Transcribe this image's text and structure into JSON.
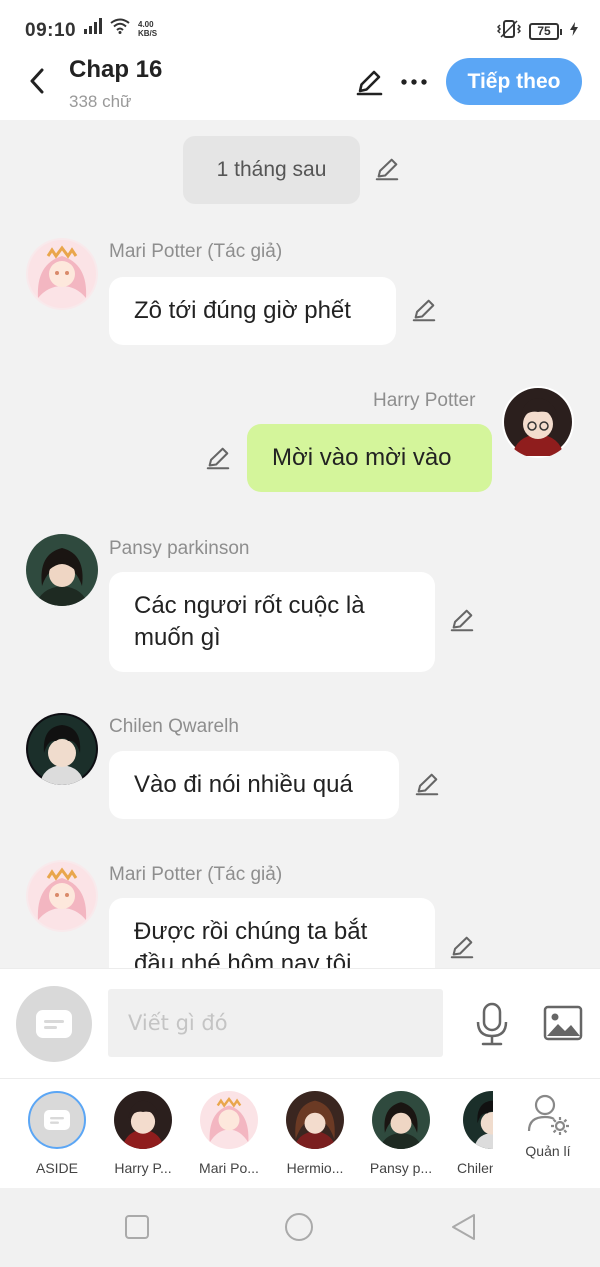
{
  "status_bar": {
    "time": "09:10",
    "net_speed_value": "4.00",
    "net_speed_unit": "KB/S",
    "battery": "75"
  },
  "header": {
    "title": "Chap 16",
    "subtitle": "338 chữ",
    "next_label": "Tiếp theo"
  },
  "chat": {
    "time_chip": "1 tháng sau",
    "messages": [
      {
        "sender": "Mari Potter (Tác giả)",
        "text": "Zô tới đúng giờ phết",
        "side": "left"
      },
      {
        "sender": "Harry Potter",
        "text": "Mời vào mời vào",
        "side": "right"
      },
      {
        "sender": "Pansy parkinson",
        "text": "Các ngươi rốt cuộc là muốn gì",
        "side": "left"
      },
      {
        "sender": "Chilen Qwarelh",
        "text": "Vào đi nói nhiều quá",
        "side": "left"
      },
      {
        "sender": "Mari Potter (Tác giả)",
        "text": "Được rồi chúng ta bắt đầu nhé hôm nay tôi",
        "side": "left"
      }
    ]
  },
  "input": {
    "placeholder": "Viết gì đó"
  },
  "characters": [
    {
      "label": "ASIDE"
    },
    {
      "label": "Harry P..."
    },
    {
      "label": "Mari Po..."
    },
    {
      "label": "Hermio..."
    },
    {
      "label": "Pansy p..."
    },
    {
      "label": "Chilen"
    }
  ],
  "manage_label": "Quản lí",
  "colors": {
    "accent": "#5ba6f5",
    "right_bubble": "#d4f59b",
    "chat_bg": "#f2f2f2"
  }
}
